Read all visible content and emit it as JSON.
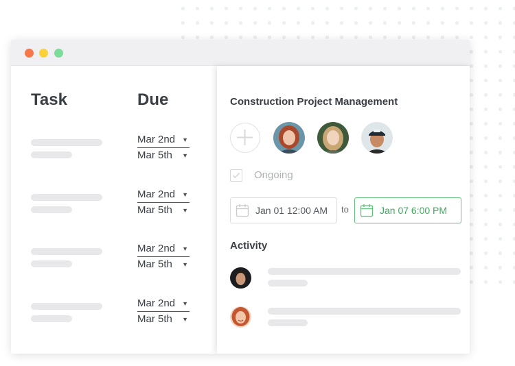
{
  "window": {
    "controls": [
      "close",
      "minimize",
      "maximize"
    ]
  },
  "task_list": {
    "task_header": "Task",
    "due_header": "Due",
    "rows": [
      {
        "start": "Mar 2nd",
        "end": "Mar 5th"
      },
      {
        "start": "Mar 2nd",
        "end": "Mar 5th"
      },
      {
        "start": "Mar 2nd",
        "end": "Mar 5th"
      },
      {
        "start": "Mar 2nd",
        "end": "Mar 5th"
      }
    ]
  },
  "detail": {
    "title": "Construction Project Management",
    "status_label": "Ongoing",
    "start_date": "Jan 01 12:00 AM",
    "to_label": "to",
    "end_date": "Jan 07 6:00 PM",
    "activity_title": "Activity",
    "assignees": [
      "woman-with-red-hair",
      "woman-with-blonde-hair",
      "man-with-cap"
    ],
    "activity_people": [
      "man-with-dark-hair",
      "woman-with-red-hair-smiling"
    ]
  },
  "colors": {
    "accent_green": "#5ec27a",
    "text_dark": "#3a3e45",
    "traffic_red": "#f7774a",
    "traffic_yellow": "#fcd23b",
    "traffic_green": "#7edc9a"
  }
}
